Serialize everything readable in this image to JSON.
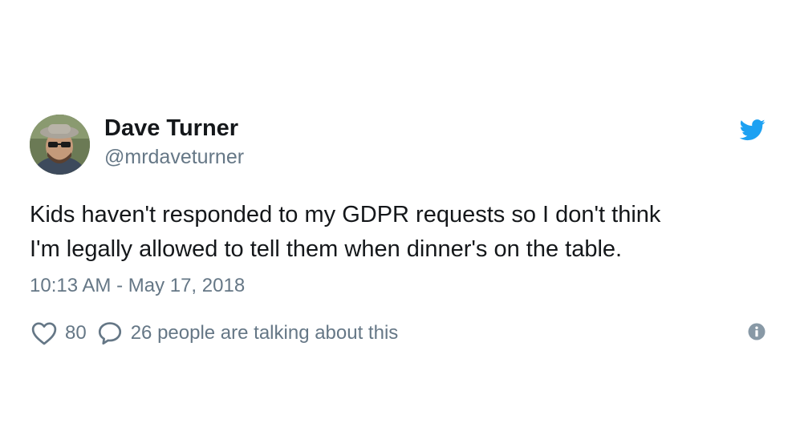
{
  "tweet": {
    "display_name": "Dave Turner",
    "handle": "@mrdaveturner",
    "text_lines": [
      "Kids haven't responded to my GDPR requests so I don't think",
      "I'm legally allowed to tell them when dinner's on the table."
    ],
    "timestamp": "10:13 AM - May 17, 2018",
    "like_count": "80",
    "conversation_text": "26 people are talking about this"
  },
  "icons": {
    "brand": "twitter-bird-icon",
    "like": "heart-icon",
    "reply": "speech-bubble-icon",
    "info": "info-icon"
  },
  "colors": {
    "text_primary": "#14171a",
    "text_secondary": "#657786",
    "brand_blue": "#1da1f2"
  }
}
